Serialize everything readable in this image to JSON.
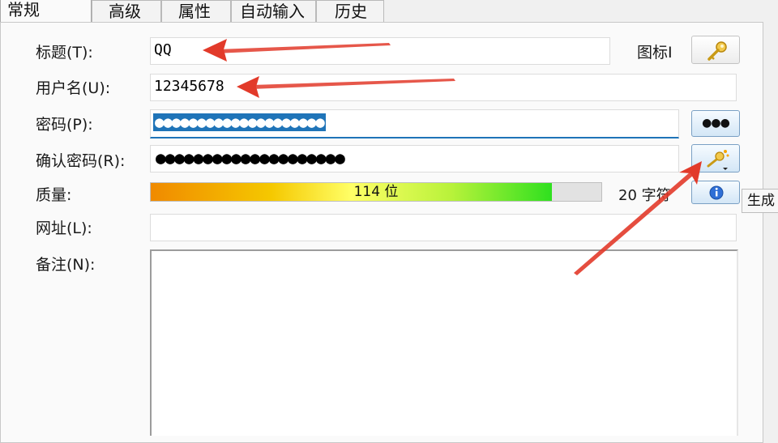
{
  "tabs": [
    "常规",
    "高级",
    "属性",
    "自动输入",
    "历史"
  ],
  "labels": {
    "title": "标题(T):",
    "username": "用户名(U):",
    "password": "密码(P):",
    "confirm": "确认密码(R):",
    "quality": "质量:",
    "url": "网址(L):",
    "notes": "备注(N):",
    "icon": "图标I"
  },
  "fields": {
    "title": "QQ",
    "username": "12345678",
    "password_masked": "●●●●●●●●●●●●●●●●●●●●",
    "confirm_masked": "●●●●●●●●●●●●●●●●●●●●",
    "url": "",
    "notes": ""
  },
  "quality": {
    "bits_text": "114 位",
    "chars_text": "20 字符",
    "fraction": 0.89
  },
  "buttons": {
    "toggle_mask_glyph": "●●●",
    "generate_tooltip": "生成"
  },
  "icons": {
    "icon_picker": "key-icon",
    "generate": "key-wand-icon",
    "info": "info-icon"
  },
  "colors": {
    "accent": "#1f74b8",
    "annotation_arrow": "#e23a2a"
  }
}
